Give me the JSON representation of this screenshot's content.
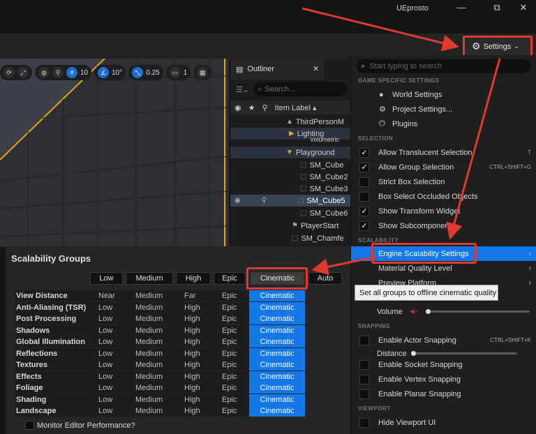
{
  "window": {
    "title": "UEprosto",
    "minimize": "—",
    "maximize": "⧉",
    "close": "✕"
  },
  "settings_button": {
    "label": "Settings",
    "chevron": "⌄"
  },
  "viewport_toolbar": {
    "grid_snap": "10",
    "rotation_snap": "10°",
    "scale_snap": "0.25",
    "camera_speed": "1"
  },
  "outliner": {
    "tab_label": "Outliner",
    "search_placeholder": "Search...",
    "column_label": "Item Label ▴",
    "rows": [
      {
        "label": "ThirdPersonM"
      },
      {
        "label": "Lighting"
      },
      {
        "label": "Volumetric"
      },
      {
        "label": "Playground"
      },
      {
        "label": "SM_Cube"
      },
      {
        "label": "SM_Cube2"
      },
      {
        "label": "SM_Cube3"
      },
      {
        "label": "SM_Cube5"
      },
      {
        "label": "SM_Cube6"
      },
      {
        "label": "PlayerStart"
      },
      {
        "label": "SM_Chamfe"
      }
    ]
  },
  "scalability": {
    "title": "Scalability Groups",
    "levels": [
      "Low",
      "Medium",
      "High",
      "Epic",
      "Cinematic",
      "Auto"
    ],
    "rows": [
      {
        "name": "View Distance",
        "values": [
          "Near",
          "Medium",
          "Far",
          "Epic",
          "Cinematic"
        ]
      },
      {
        "name": "Anti-Aliasing (TSR)",
        "values": [
          "Low",
          "Medium",
          "High",
          "Epic",
          "Cinematic"
        ]
      },
      {
        "name": "Post Processing",
        "values": [
          "Low",
          "Medium",
          "High",
          "Epic",
          "Cinematic"
        ]
      },
      {
        "name": "Shadows",
        "values": [
          "Low",
          "Medium",
          "High",
          "Epic",
          "Cinematic"
        ]
      },
      {
        "name": "Global Illumination",
        "values": [
          "Low",
          "Medium",
          "High",
          "Epic",
          "Cinematic"
        ]
      },
      {
        "name": "Reflections",
        "values": [
          "Low",
          "Medium",
          "High",
          "Epic",
          "Cinematic"
        ]
      },
      {
        "name": "Textures",
        "values": [
          "Low",
          "Medium",
          "High",
          "Epic",
          "Cinematic"
        ]
      },
      {
        "name": "Effects",
        "values": [
          "Low",
          "Medium",
          "High",
          "Epic",
          "Cinematic"
        ]
      },
      {
        "name": "Foliage",
        "values": [
          "Low",
          "Medium",
          "High",
          "Epic",
          "Cinematic"
        ]
      },
      {
        "name": "Shading",
        "values": [
          "Low",
          "Medium",
          "High",
          "Epic",
          "Cinematic"
        ]
      },
      {
        "name": "Landscape",
        "values": [
          "Low",
          "Medium",
          "High",
          "Epic",
          "Cinematic"
        ]
      }
    ],
    "monitor_label": "Monitor Editor Performance?"
  },
  "menu": {
    "search_placeholder": "Start typing to search",
    "sections": {
      "game": "GAME SPECIFIC SETTINGS",
      "selection": "SELECTION",
      "scalability": "SCALABILITY",
      "snapping": "SNAPPING",
      "viewport": "VIEWPORT"
    },
    "world_settings": "World Settings",
    "project_settings": "Project Settings...",
    "plugins": "Plugins",
    "selection_items": [
      {
        "label": "Allow Translucent Selection",
        "checked": true,
        "shortcut": "T"
      },
      {
        "label": "Allow Group Selection",
        "checked": true,
        "shortcut": "CTRL+SHIFT+G"
      },
      {
        "label": "Strict Box Selection",
        "checked": false,
        "shortcut": ""
      },
      {
        "label": "Box Select Occluded Objects",
        "checked": false,
        "shortcut": ""
      },
      {
        "label": "Show Transform Widget",
        "checked": true,
        "shortcut": ""
      },
      {
        "label": "Show Subcomponents",
        "checked": true,
        "shortcut": ""
      }
    ],
    "engine_scalability": "Engine Scalability Settings",
    "material_quality": "Material Quality Level",
    "preview_platform": "Preview Platform",
    "volume_label": "Volume",
    "snapping_items": [
      {
        "label": "Enable Actor Snapping",
        "shortcut": "CTRL+SHIFT+K"
      },
      {
        "label": "Distance",
        "shortcut": ""
      },
      {
        "label": "Enable Socket Snapping",
        "shortcut": ""
      },
      {
        "label": "Enable Vertex Snapping",
        "shortcut": ""
      },
      {
        "label": "Enable Planar Snapping",
        "shortcut": ""
      }
    ],
    "hide_viewport_ui": "Hide Viewport UI",
    "check_glyph": "✓"
  },
  "tooltip": "Set all groups to offline cinematic quality",
  "colors": {
    "accent_blue": "#1477e8",
    "highlight_red": "#e03a2f",
    "viewport_edge": "#e8a317"
  }
}
